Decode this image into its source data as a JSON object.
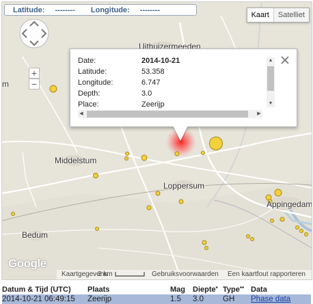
{
  "coords": {
    "latitude_label": "Latitude:",
    "latitude_value": "--------",
    "longitude_label": "Longitude:",
    "longitude_value": "--------"
  },
  "map_type": {
    "map_label": "Kaart",
    "satellite_label": "Satelliet",
    "selected": "Kaart"
  },
  "zoom": {
    "in": "+",
    "out": "−"
  },
  "places": {
    "uithuizermeeden": "Uithuizermeeden",
    "middelstum": "Middelstum",
    "loppersum": "Loppersum",
    "appingedam": "Appingedam",
    "bedum": "Bedum",
    "partial_left": "m"
  },
  "info_window": {
    "rows": [
      {
        "key": "Date:",
        "value": "2014-10-21",
        "bold": true
      },
      {
        "key": "Latitude:",
        "value": "53.358"
      },
      {
        "key": "Longitude:",
        "value": "6.747"
      },
      {
        "key": "Depth:",
        "value": "3.0"
      },
      {
        "key": "Place:",
        "value": "Zeerijp"
      }
    ],
    "close_icon": "close-x"
  },
  "attribution": {
    "logo": "Google",
    "map_data": "Kaartgegevens",
    "scale": "2 km",
    "terms": "Gebruiksvoorwaarden",
    "report": "Een kaartfout rapporteren"
  },
  "colors": {
    "land": "#e7e4da",
    "road": "#ffffff",
    "quake_fill": "#f2d23a",
    "quake_stroke": "#a8871a",
    "selected_marker": "#ff2a2a",
    "row_highlight": "#a7b8d9",
    "coord_text": "#3d5f86"
  },
  "results": {
    "headers": {
      "datetime": "Datum & Tijd (UTC)",
      "place": "Plaats",
      "mag": "Mag",
      "depth": "Diepte",
      "type": "Type",
      "data": "Data"
    },
    "sort_marks": {
      "depth": "*",
      "type": "**"
    },
    "rows": [
      {
        "datetime": "2014-10-21 06:49:15",
        "place": "Zeerijp",
        "mag": "1.5",
        "depth": "3.0",
        "type": "GH",
        "data": "Phase data"
      }
    ]
  }
}
